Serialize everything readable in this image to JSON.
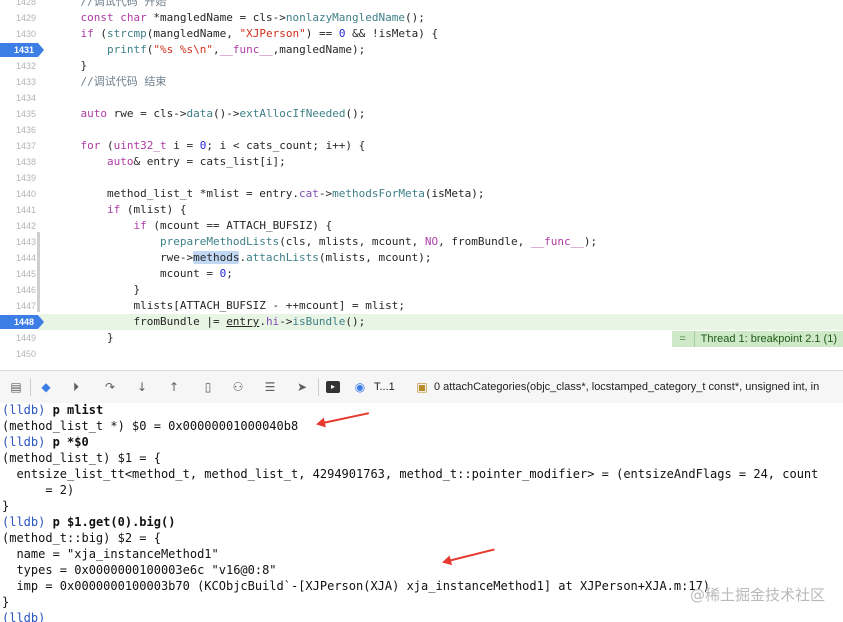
{
  "editor": {
    "lines": [
      {
        "num": "1428",
        "code": "    //调试代码 开始"
      },
      {
        "num": "1429",
        "code": "    const char *mangledName = cls->nonlazyMangledName();"
      },
      {
        "num": "1430",
        "code": "    if (strcmp(mangledName, \"XJPerson\") == 0 && !isMeta) {"
      },
      {
        "num": "1431",
        "code": "        printf(\"%s %s\\n\",__func__,mangledName);",
        "breakpoint": true
      },
      {
        "num": "1432",
        "code": "    }"
      },
      {
        "num": "1433",
        "code": "    //调试代码 结束"
      },
      {
        "num": "1434",
        "code": ""
      },
      {
        "num": "1435",
        "code": "    auto rwe = cls->data()->extAllocIfNeeded();"
      },
      {
        "num": "1436",
        "code": ""
      },
      {
        "num": "1437",
        "code": "    for (uint32_t i = 0; i < cats_count; i++) {"
      },
      {
        "num": "1438",
        "code": "        auto& entry = cats_list[i];"
      },
      {
        "num": "1439",
        "code": ""
      },
      {
        "num": "1440",
        "code": "        method_list_t *mlist = entry.cat->methodsForMeta(isMeta);"
      },
      {
        "num": "1441",
        "code": "        if (mlist) {"
      },
      {
        "num": "1442",
        "code": "            if (mcount == ATTACH_BUFSIZ) {"
      },
      {
        "num": "1443",
        "code": "                prepareMethodLists(cls, mlists, mcount, NO, fromBundle, __func__);"
      },
      {
        "num": "1444",
        "code": "                rwe->methods.attachLists(mlists, mcount);"
      },
      {
        "num": "1445",
        "code": "                mcount = 0;"
      },
      {
        "num": "1446",
        "code": "            }"
      },
      {
        "num": "1447",
        "code": "            mlists[ATTACH_BUFSIZ - ++mcount] = mlist;"
      },
      {
        "num": "1448",
        "code": "            fromBundle |= entry.hi->isBundle();",
        "breakpoint": true,
        "current": true
      },
      {
        "num": "1449",
        "code": "        }"
      },
      {
        "num": "1450",
        "code": ""
      }
    ],
    "thread_badge": {
      "icon": "=",
      "text": "Thread 1: breakpoint 2.1 (1)"
    }
  },
  "debugbar": {
    "thread": "T...1",
    "frame": "0 attachCategories(objc_class*, locstamped_category_t const*, unsigned int, in"
  },
  "console": {
    "lines": [
      {
        "prompt": "(lldb)",
        "cmd": "p mlist"
      },
      {
        "text": "(method_list_t *) $0 = 0x00000001000040b8"
      },
      {
        "prompt": "(lldb)",
        "cmd": "p *$0"
      },
      {
        "text": "(method_list_t) $1 = {"
      },
      {
        "text": "  entsize_list_tt<method_t, method_list_t, 4294901763, method_t::pointer_modifier> = (entsizeAndFlags = 24, count"
      },
      {
        "text": "      = 2)"
      },
      {
        "text": "}"
      },
      {
        "prompt": "(lldb)",
        "cmd": "p $1.get(0).big()"
      },
      {
        "text": "(method_t::big) $2 = {"
      },
      {
        "text": "  name = \"xja_instanceMethod1\""
      },
      {
        "text": "  types = 0x0000000100003e6c \"v16@0:8\""
      },
      {
        "text": "  imp = 0x0000000100003b70 (KCObjcBuild`-[XJPerson(XJA) xja_instanceMethod1] at XJPerson+XJA.m:17)"
      },
      {
        "text": "}"
      },
      {
        "prompt": "(lldb)",
        "cmd": ""
      }
    ]
  },
  "watermark": "@稀土掘金技术社区",
  "colors": {
    "breakpoint": "#3d7ee6",
    "current_line": "#e8f4e4",
    "thread_badge": "#cfe9c8",
    "annotation_arrow": "#e63a2e",
    "prompt": "#2a54c6"
  }
}
